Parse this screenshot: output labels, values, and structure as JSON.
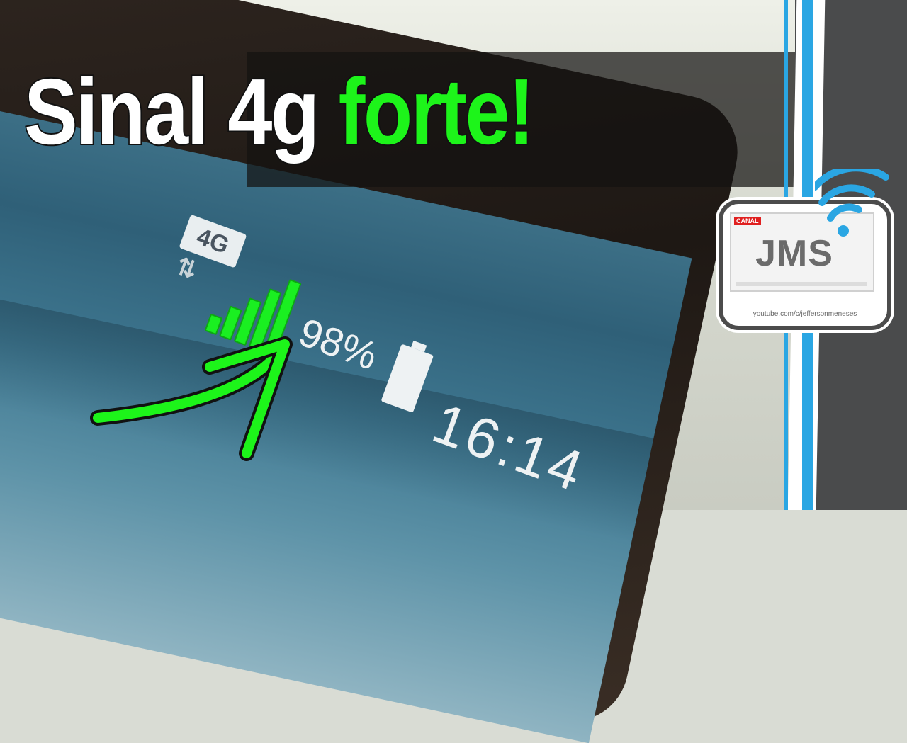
{
  "title": {
    "part1": "Sinal 4g",
    "part2": "forte!"
  },
  "status_bar": {
    "network_badge": "4G",
    "battery_percent": "98%",
    "time": "16:14",
    "signal_bars": 5
  },
  "logo": {
    "canal_label": "CANAL",
    "name": "JMS",
    "url": "youtube.com/c/jeffersonmeneses"
  },
  "colors": {
    "accent_green": "#1df41a",
    "accent_blue": "#2aa6e3"
  }
}
